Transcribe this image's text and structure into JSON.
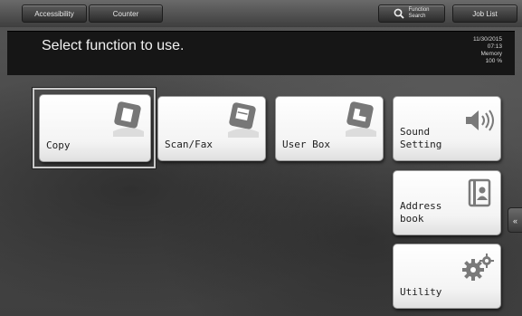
{
  "toolbar": {
    "accessibility_label": "Accessibility",
    "counter_label": "Counter",
    "function_search_label_line1": "Function",
    "function_search_label_line2": "Search",
    "job_list_label": "Job List"
  },
  "message": {
    "title": "Select function to use."
  },
  "status": {
    "date": "11/30/2015",
    "time": "07:13",
    "memory_label": "Memory",
    "memory_value": "100 %"
  },
  "tiles": {
    "copy": "Copy",
    "scan_fax": "Scan/Fax",
    "user_box": "User Box",
    "sound_setting_line1": "Sound",
    "sound_setting_line2": "Setting",
    "address_book_line1": "Address",
    "address_book_line2": "book",
    "utility": "Utility"
  },
  "icons": {
    "copy": "copy-doc-icon",
    "scan_fax": "scan-fax-icon",
    "user_box": "user-box-icon",
    "sound": "speaker-icon",
    "address": "address-book-icon",
    "utility": "gear-icon",
    "side_tab": "double-chevron-left-icon"
  },
  "colors": {
    "tile_bg": "#ffffff",
    "icon_gray": "#7a7a7a",
    "message_bar": "#161616"
  }
}
